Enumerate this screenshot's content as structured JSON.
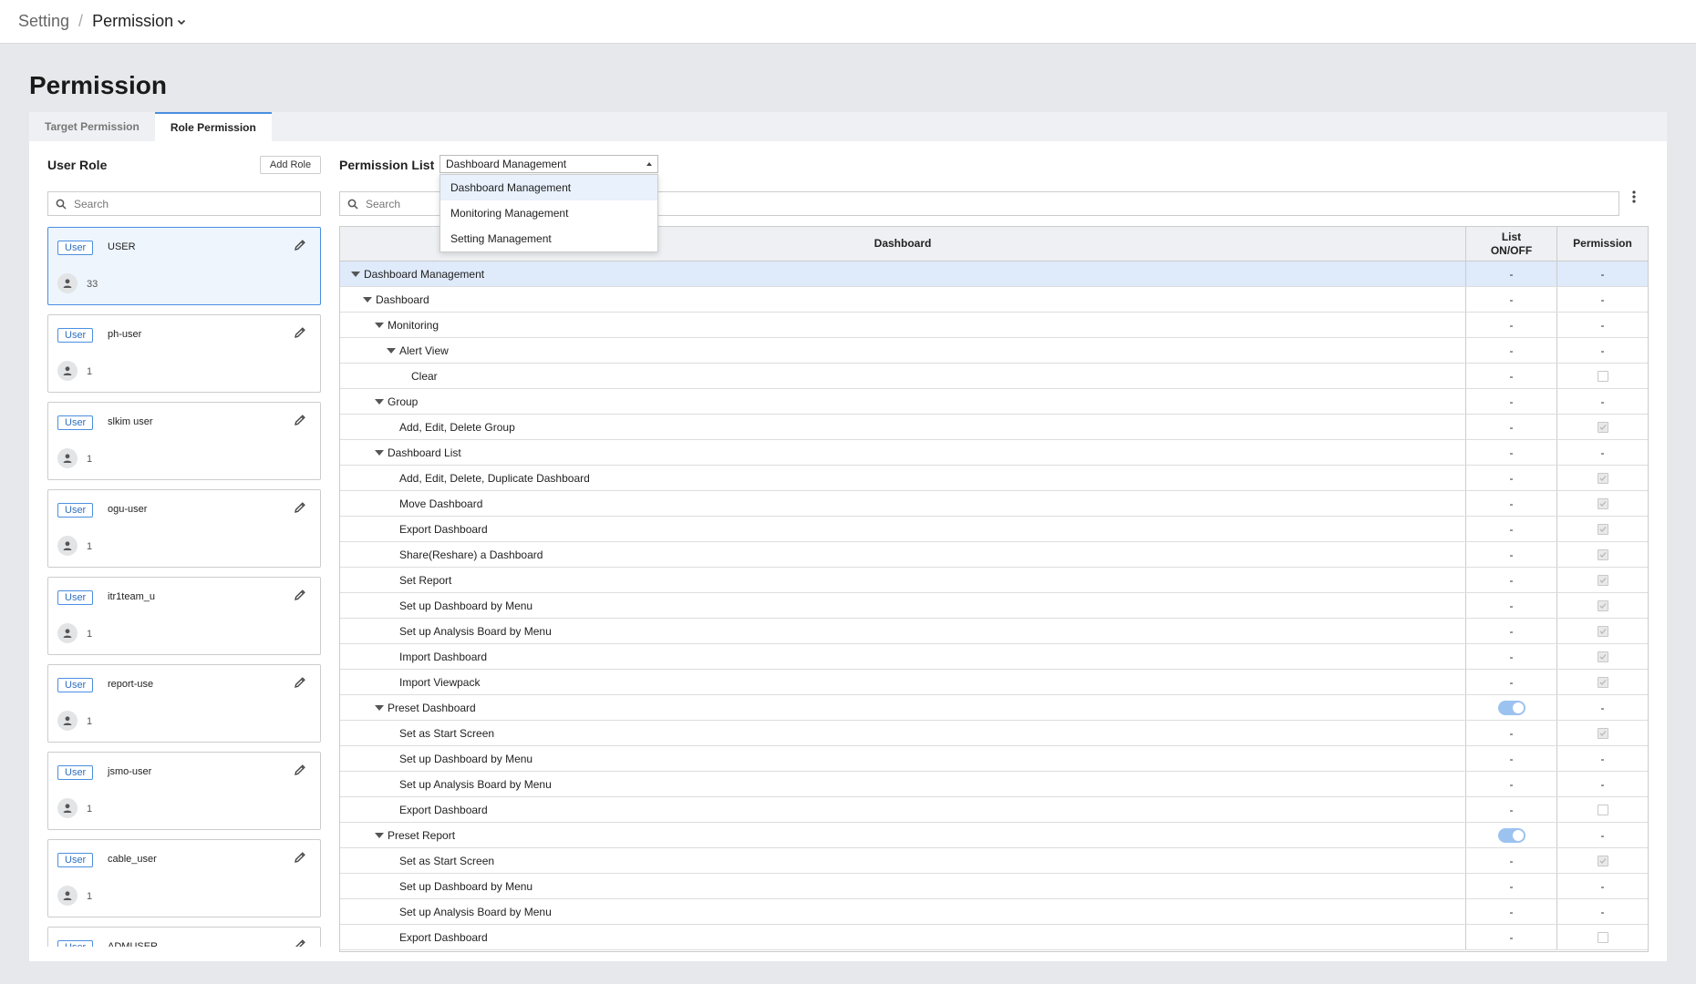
{
  "breadcrumb": {
    "root": "Setting",
    "separator": "/",
    "current": "Permission"
  },
  "page": {
    "title": "Permission"
  },
  "tabs": [
    {
      "label": "Target Permission",
      "active": false
    },
    {
      "label": "Role Permission",
      "active": true
    }
  ],
  "roles_panel": {
    "title": "User Role",
    "add_button": "Add Role",
    "search_placeholder": "Search",
    "roles": [
      {
        "badge": "User",
        "name": "USER",
        "count": "33",
        "selected": true
      },
      {
        "badge": "User",
        "name": "ph-user",
        "count": "1"
      },
      {
        "badge": "User",
        "name": "slkim user",
        "count": "1"
      },
      {
        "badge": "User",
        "name": "ogu-user",
        "count": "1"
      },
      {
        "badge": "User",
        "name": "itr1team_u",
        "count": "1"
      },
      {
        "badge": "User",
        "name": "report-use",
        "count": "1"
      },
      {
        "badge": "User",
        "name": "jsmo-user",
        "count": "1"
      },
      {
        "badge": "User",
        "name": "cable_user",
        "count": "1"
      },
      {
        "badge": "User",
        "name": "ADMUSER",
        "count": ""
      }
    ]
  },
  "permission_panel": {
    "title": "Permission List",
    "selected": "Dashboard Management",
    "options": [
      "Dashboard Management",
      "Monitoring Management",
      "Setting Management"
    ],
    "search_placeholder": "Search",
    "columns": [
      "Dashboard",
      "List\nON/OFF",
      "Permission"
    ],
    "rows": [
      {
        "label": "Dashboard Management",
        "level": 0,
        "expand": true,
        "list": "-",
        "perm": "-",
        "highlight": true
      },
      {
        "label": "Dashboard",
        "level": 1,
        "expand": true,
        "list": "-",
        "perm": "-"
      },
      {
        "label": "Monitoring",
        "level": 2,
        "expand": true,
        "list": "-",
        "perm": "-"
      },
      {
        "label": "Alert View",
        "level": 3,
        "expand": true,
        "list": "-",
        "perm": "-"
      },
      {
        "label": "Clear",
        "level": 4,
        "list": "-",
        "perm": "checkbox_off"
      },
      {
        "label": "Group",
        "level": 2,
        "expand": true,
        "list": "-",
        "perm": "-"
      },
      {
        "label": "Add, Edit, Delete Group",
        "level": 3,
        "list": "-",
        "perm": "checkbox_on"
      },
      {
        "label": "Dashboard List",
        "level": 2,
        "expand": true,
        "list": "-",
        "perm": "-"
      },
      {
        "label": "Add, Edit, Delete, Duplicate Dashboard",
        "level": 3,
        "list": "-",
        "perm": "checkbox_on"
      },
      {
        "label": "Move Dashboard",
        "level": 3,
        "list": "-",
        "perm": "checkbox_on"
      },
      {
        "label": "Export Dashboard",
        "level": 3,
        "list": "-",
        "perm": "checkbox_on"
      },
      {
        "label": "Share(Reshare) a Dashboard",
        "level": 3,
        "list": "-",
        "perm": "checkbox_on"
      },
      {
        "label": "Set Report",
        "level": 3,
        "list": "-",
        "perm": "checkbox_on"
      },
      {
        "label": "Set up Dashboard by Menu",
        "level": 3,
        "list": "-",
        "perm": "checkbox_on"
      },
      {
        "label": "Set up Analysis Board by Menu",
        "level": 3,
        "list": "-",
        "perm": "checkbox_on"
      },
      {
        "label": "Import Dashboard",
        "level": 3,
        "list": "-",
        "perm": "checkbox_on"
      },
      {
        "label": "Import Viewpack",
        "level": 3,
        "list": "-",
        "perm": "checkbox_on"
      },
      {
        "label": "Preset Dashboard",
        "level": 2,
        "expand": true,
        "list": "toggle_on",
        "perm": "-"
      },
      {
        "label": "Set as Start Screen",
        "level": 3,
        "list": "-",
        "perm": "checkbox_on"
      },
      {
        "label": "Set up Dashboard by Menu",
        "level": 3,
        "list": "-",
        "perm": "-"
      },
      {
        "label": "Set up Analysis Board by Menu",
        "level": 3,
        "list": "-",
        "perm": "-"
      },
      {
        "label": "Export Dashboard",
        "level": 3,
        "list": "-",
        "perm": "checkbox_off"
      },
      {
        "label": "Preset Report",
        "level": 2,
        "expand": true,
        "list": "toggle_on",
        "perm": "-"
      },
      {
        "label": "Set as Start Screen",
        "level": 3,
        "list": "-",
        "perm": "checkbox_on"
      },
      {
        "label": "Set up Dashboard by Menu",
        "level": 3,
        "list": "-",
        "perm": "-"
      },
      {
        "label": "Set up Analysis Board by Menu",
        "level": 3,
        "list": "-",
        "perm": "-"
      },
      {
        "label": "Export Dashboard",
        "level": 3,
        "list": "-",
        "perm": "checkbox_off"
      }
    ]
  },
  "colors": {
    "accent": "#4a8fe0",
    "highlight_row": "#dfeafa",
    "toggle": "#9cc2ef"
  }
}
